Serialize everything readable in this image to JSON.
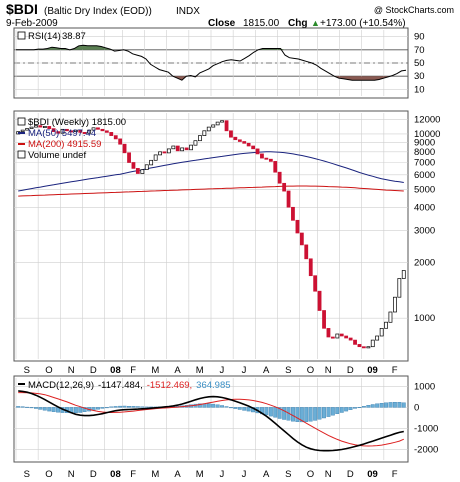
{
  "header": {
    "symbol": "$BDI",
    "name": "(Baltic Dry Index (EOD))",
    "exchange": "INDX",
    "date": "9-Feb-2009",
    "copyright": "@ StockCharts.com",
    "close_label": "Close",
    "close_value": "1815.00",
    "chg_label": "Chg",
    "chg_value": "+173.00 (+10.54%)",
    "chg_arrow": "▲"
  },
  "colors": {
    "up_candle": "#ffffff",
    "down_candle": "#cc1133",
    "ma50": "#1a237e",
    "ma200": "#cc1111",
    "rsi_line": "#000000",
    "rsi_overbought_fill": "#5a7f52",
    "rsi_oversold_fill": "#8a5a52",
    "macd_line": "#000000",
    "signal_line": "#dd2222",
    "histogram": "#6aaed6",
    "grid": "#cfcfcf"
  },
  "chart_data": [
    {
      "type": "line",
      "title": "RSI(14) 38.87",
      "legend": {
        "label": "RSI(14)",
        "value": "38.87"
      },
      "ylim": [
        0,
        100
      ],
      "yticks": [
        "90",
        "70",
        "50",
        "30",
        "10"
      ],
      "reference_lines": [
        70,
        50,
        30
      ],
      "series": [
        {
          "name": "RSI(14)",
          "values": [
            70,
            70,
            70,
            70,
            70,
            71,
            71,
            72,
            74,
            73,
            72,
            72,
            70,
            72,
            76,
            77,
            76,
            76,
            76,
            75,
            73,
            71,
            68,
            69,
            70,
            68,
            64,
            62,
            60,
            56,
            48,
            44,
            40,
            38,
            36,
            30,
            27,
            24,
            30,
            31,
            29,
            35,
            38,
            41,
            46,
            49,
            52,
            54,
            55,
            54,
            53,
            57,
            61,
            66,
            70,
            72,
            72,
            72,
            72,
            72,
            62,
            58,
            57,
            56,
            54,
            52,
            50,
            47,
            42,
            38,
            34,
            30,
            27,
            26,
            25,
            24,
            24,
            24,
            24,
            24,
            24,
            25,
            27,
            29,
            31,
            34,
            38,
            39
          ]
        }
      ]
    },
    {
      "type": "candlestick",
      "title": "$BDI (Weekly) 1815.00",
      "legend": [
        {
          "label": "$BDI (Weekly) 1815.00"
        },
        {
          "label": "MA(50) 5497.44"
        },
        {
          "label": "MA(200) 4915.59"
        },
        {
          "label": "Volume undef"
        }
      ],
      "y_scale": "log",
      "ylim": [
        600,
        13000
      ],
      "yticks": [
        "12000",
        "10000",
        "9000",
        "8000",
        "7000",
        "6000",
        "5000",
        "4000",
        "3000",
        "2000",
        "1000"
      ],
      "x_months": [
        "S",
        "O",
        "N",
        "D",
        "08",
        "F",
        "M",
        "A",
        "M",
        "J",
        "J",
        "A",
        "S",
        "O",
        "N",
        "D",
        "09",
        "F"
      ],
      "candles": [
        {
          "o": 10000,
          "c": 10300
        },
        {
          "o": 10300,
          "c": 10500
        },
        {
          "o": 10500,
          "c": 10700
        },
        {
          "o": 10700,
          "c": 10900
        },
        {
          "o": 10900,
          "c": 11100
        },
        {
          "o": 11100,
          "c": 10900
        },
        {
          "o": 10900,
          "c": 11000
        },
        {
          "o": 11000,
          "c": 10700
        },
        {
          "o": 10700,
          "c": 10300
        },
        {
          "o": 10300,
          "c": 10100
        },
        {
          "o": 10100,
          "c": 10600
        },
        {
          "o": 10600,
          "c": 10400
        },
        {
          "o": 10400,
          "c": 10300
        },
        {
          "o": 10300,
          "c": 10500
        },
        {
          "o": 10500,
          "c": 10200
        },
        {
          "o": 10200,
          "c": 10100
        },
        {
          "o": 10100,
          "c": 10500
        },
        {
          "o": 10500,
          "c": 10800
        },
        {
          "o": 10800,
          "c": 10600
        },
        {
          "o": 10600,
          "c": 10400
        },
        {
          "o": 10400,
          "c": 10200
        },
        {
          "o": 10200,
          "c": 9800
        },
        {
          "o": 9800,
          "c": 9400
        },
        {
          "o": 9400,
          "c": 8800
        },
        {
          "o": 8800,
          "c": 7900
        },
        {
          "o": 7900,
          "c": 7000
        },
        {
          "o": 7000,
          "c": 6500
        },
        {
          "o": 6500,
          "c": 6100
        },
        {
          "o": 6100,
          "c": 6400
        },
        {
          "o": 6400,
          "c": 6800
        },
        {
          "o": 6800,
          "c": 7200
        },
        {
          "o": 7200,
          "c": 7700
        },
        {
          "o": 7700,
          "c": 8000
        },
        {
          "o": 8000,
          "c": 7900
        },
        {
          "o": 7900,
          "c": 8300
        },
        {
          "o": 8300,
          "c": 8600
        },
        {
          "o": 8600,
          "c": 8100
        },
        {
          "o": 8100,
          "c": 8400
        },
        {
          "o": 8400,
          "c": 8200
        },
        {
          "o": 8200,
          "c": 8700
        },
        {
          "o": 8700,
          "c": 9200
        },
        {
          "o": 9200,
          "c": 9800
        },
        {
          "o": 9800,
          "c": 10400
        },
        {
          "o": 10400,
          "c": 10900
        },
        {
          "o": 10900,
          "c": 11200
        },
        {
          "o": 11200,
          "c": 11600
        },
        {
          "o": 11600,
          "c": 11800
        },
        {
          "o": 11800,
          "c": 10400
        },
        {
          "o": 10400,
          "c": 9600
        },
        {
          "o": 9600,
          "c": 9300
        },
        {
          "o": 9300,
          "c": 9100
        },
        {
          "o": 9100,
          "c": 8900
        },
        {
          "o": 8900,
          "c": 8600
        },
        {
          "o": 8600,
          "c": 8300
        },
        {
          "o": 8300,
          "c": 7800
        },
        {
          "o": 7800,
          "c": 7400
        },
        {
          "o": 7400,
          "c": 7300
        },
        {
          "o": 7300,
          "c": 7100
        },
        {
          "o": 7100,
          "c": 6200
        },
        {
          "o": 6200,
          "c": 5400
        },
        {
          "o": 5400,
          "c": 4900
        },
        {
          "o": 4900,
          "c": 4000
        },
        {
          "o": 4000,
          "c": 3400
        },
        {
          "o": 3400,
          "c": 2900
        },
        {
          "o": 2900,
          "c": 2500
        },
        {
          "o": 2500,
          "c": 2100
        },
        {
          "o": 2100,
          "c": 1700
        },
        {
          "o": 1700,
          "c": 1400
        },
        {
          "o": 1400,
          "c": 1100
        },
        {
          "o": 1100,
          "c": 880
        },
        {
          "o": 880,
          "c": 790
        },
        {
          "o": 790,
          "c": 780
        },
        {
          "o": 780,
          "c": 820
        },
        {
          "o": 820,
          "c": 800
        },
        {
          "o": 800,
          "c": 780
        },
        {
          "o": 780,
          "c": 760
        },
        {
          "o": 760,
          "c": 720
        },
        {
          "o": 720,
          "c": 700
        },
        {
          "o": 700,
          "c": 690
        },
        {
          "o": 690,
          "c": 700
        },
        {
          "o": 700,
          "c": 760
        },
        {
          "o": 760,
          "c": 800
        },
        {
          "o": 800,
          "c": 880
        },
        {
          "o": 880,
          "c": 950
        },
        {
          "o": 950,
          "c": 1080
        },
        {
          "o": 1080,
          "c": 1300
        },
        {
          "o": 1300,
          "c": 1642
        },
        {
          "o": 1642,
          "c": 1815
        }
      ],
      "series": [
        {
          "name": "MA(50)",
          "values": [
            4900,
            4950,
            5000,
            5050,
            5100,
            5150,
            5200,
            5250,
            5300,
            5350,
            5400,
            5450,
            5500,
            5550,
            5600,
            5650,
            5700,
            5750,
            5800,
            5850,
            5900,
            5950,
            6000,
            6050,
            6120,
            6190,
            6260,
            6330,
            6400,
            6470,
            6540,
            6610,
            6680,
            6750,
            6820,
            6890,
            6960,
            7020,
            7080,
            7140,
            7200,
            7260,
            7320,
            7380,
            7440,
            7500,
            7560,
            7620,
            7680,
            7740,
            7800,
            7840,
            7880,
            7920,
            7950,
            7980,
            8000,
            8000,
            7980,
            7960,
            7920,
            7860,
            7800,
            7720,
            7640,
            7550,
            7450,
            7350,
            7240,
            7130,
            7020,
            6900,
            6780,
            6660,
            6540,
            6420,
            6300,
            6180,
            6080,
            5980,
            5890,
            5800,
            5720,
            5650,
            5590,
            5540,
            5497,
            5450
          ]
        },
        {
          "name": "MA(200)",
          "values": [
            4600,
            4610,
            4620,
            4630,
            4640,
            4650,
            4660,
            4670,
            4680,
            4690,
            4700,
            4710,
            4720,
            4730,
            4740,
            4750,
            4760,
            4770,
            4780,
            4790,
            4800,
            4810,
            4820,
            4830,
            4840,
            4850,
            4860,
            4870,
            4880,
            4890,
            4900,
            4910,
            4920,
            4930,
            4940,
            4950,
            4960,
            4970,
            4980,
            4990,
            5000,
            5010,
            5020,
            5030,
            5040,
            5050,
            5060,
            5070,
            5080,
            5090,
            5100,
            5110,
            5120,
            5130,
            5140,
            5150,
            5160,
            5170,
            5180,
            5190,
            5200,
            5210,
            5215,
            5220,
            5220,
            5220,
            5215,
            5210,
            5200,
            5190,
            5180,
            5170,
            5160,
            5150,
            5140,
            5120,
            5100,
            5080,
            5060,
            5040,
            5020,
            5000,
            4980,
            4960,
            4950,
            4935,
            4915,
            4900
          ]
        }
      ]
    },
    {
      "type": "line",
      "title": "MACD(12,26,9) -1147.484, -1512.469, 364.985",
      "legend": {
        "label": "MACD(12,26,9)",
        "macd": "-1147.484,",
        "signal": "-1512.469,",
        "hist": "364.985"
      },
      "ylim": [
        -2500,
        1300
      ],
      "yticks": [
        "1000",
        "0",
        "-1000",
        "-2000"
      ],
      "series": [
        {
          "name": "MACD",
          "values": [
            780,
            760,
            720,
            660,
            580,
            480,
            370,
            250,
            130,
            20,
            -80,
            -170,
            -260,
            -330,
            -370,
            -390,
            -390,
            -370,
            -340,
            -300,
            -250,
            -200,
            -160,
            -130,
            -110,
            -100,
            -90,
            -80,
            -70,
            -60,
            -40,
            -20,
            0,
            20,
            40,
            70,
            110,
            160,
            220,
            290,
            360,
            420,
            470,
            500,
            510,
            500,
            470,
            420,
            360,
            290,
            220,
            140,
            60,
            -40,
            -150,
            -280,
            -420,
            -580,
            -760,
            -940,
            -1120,
            -1300,
            -1480,
            -1640,
            -1780,
            -1890,
            -1970,
            -2020,
            -2050,
            -2060,
            -2060,
            -2050,
            -2030,
            -2000,
            -1960,
            -1910,
            -1860,
            -1800,
            -1740,
            -1670,
            -1600,
            -1530,
            -1460,
            -1390,
            -1320,
            -1250,
            -1190,
            -1147
          ]
        },
        {
          "name": "Signal",
          "values": [
            700,
            700,
            695,
            685,
            665,
            640,
            600,
            540,
            470,
            400,
            330,
            260,
            180,
            100,
            30,
            -40,
            -100,
            -150,
            -190,
            -220,
            -240,
            -245,
            -240,
            -230,
            -215,
            -195,
            -175,
            -150,
            -125,
            -100,
            -80,
            -60,
            -45,
            -30,
            -15,
            0,
            15,
            35,
            55,
            80,
            105,
            135,
            170,
            210,
            250,
            290,
            325,
            355,
            375,
            385,
            385,
            375,
            355,
            325,
            285,
            235,
            175,
            105,
            25,
            -65,
            -165,
            -275,
            -390,
            -510,
            -630,
            -750,
            -870,
            -990,
            -1110,
            -1220,
            -1330,
            -1430,
            -1520,
            -1600,
            -1670,
            -1730,
            -1780,
            -1810,
            -1830,
            -1835,
            -1830,
            -1815,
            -1790,
            -1755,
            -1710,
            -1660,
            -1600,
            -1512
          ]
        }
      ],
      "x_months": [
        "S",
        "O",
        "N",
        "D",
        "08",
        "F",
        "M",
        "A",
        "M",
        "J",
        "J",
        "A",
        "S",
        "O",
        "N",
        "D",
        "09",
        "F"
      ]
    }
  ]
}
